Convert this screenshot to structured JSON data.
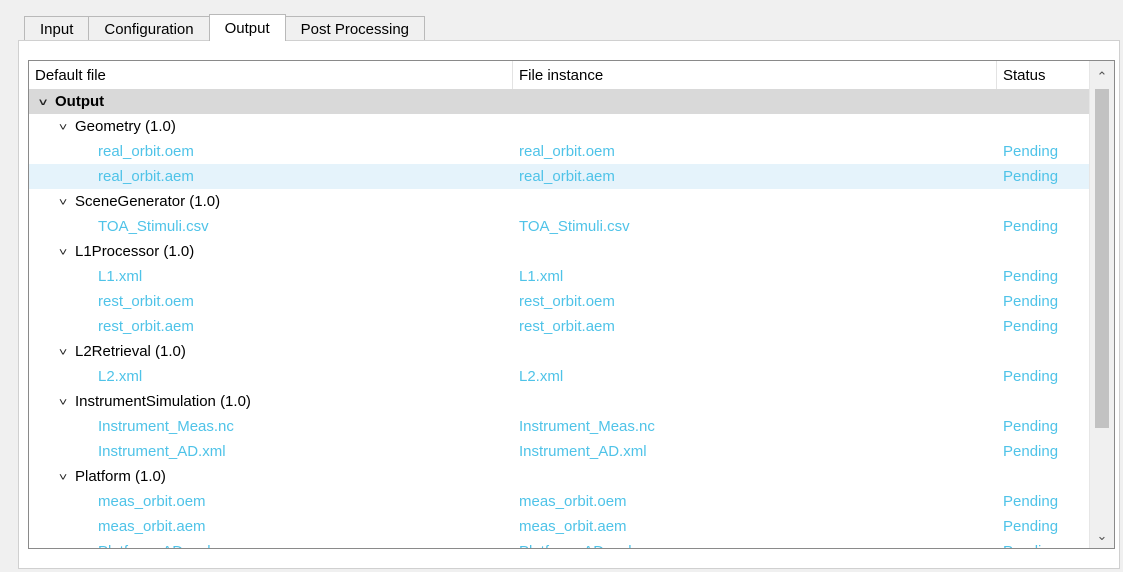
{
  "tabs": [
    {
      "label": "Input"
    },
    {
      "label": "Configuration"
    },
    {
      "label": "Output"
    },
    {
      "label": "Post Processing"
    }
  ],
  "active_tab": "Output",
  "columns": {
    "default_file": "Default file",
    "file_instance": "File instance",
    "status": "Status"
  },
  "icons": {
    "expand": "chevron-down-icon",
    "scroll_up": "scroll-up-arrow-icon",
    "scroll_down": "scroll-down-arrow-icon"
  },
  "colors": {
    "file_text": "#4fc3e8",
    "root_row_bg": "#d9d9d9",
    "selected_row_bg": "#e5f3fb"
  },
  "rows": [
    {
      "type": "root",
      "label": "Output"
    },
    {
      "type": "group",
      "label": "Geometry (1.0)"
    },
    {
      "type": "file",
      "default": "real_orbit.oem",
      "instance": "real_orbit.oem",
      "status": "Pending"
    },
    {
      "type": "file",
      "default": "real_orbit.aem",
      "instance": "real_orbit.aem",
      "status": "Pending",
      "selected": true
    },
    {
      "type": "group",
      "label": "SceneGenerator (1.0)"
    },
    {
      "type": "file",
      "default": "TOA_Stimuli.csv",
      "instance": "TOA_Stimuli.csv",
      "status": "Pending"
    },
    {
      "type": "group",
      "label": "L1Processor (1.0)"
    },
    {
      "type": "file",
      "default": "L1.xml",
      "instance": "L1.xml",
      "status": "Pending"
    },
    {
      "type": "file",
      "default": "rest_orbit.oem",
      "instance": "rest_orbit.oem",
      "status": "Pending"
    },
    {
      "type": "file",
      "default": "rest_orbit.aem",
      "instance": "rest_orbit.aem",
      "status": "Pending"
    },
    {
      "type": "group",
      "label": "L2Retrieval (1.0)"
    },
    {
      "type": "file",
      "default": "L2.xml",
      "instance": "L2.xml",
      "status": "Pending"
    },
    {
      "type": "group",
      "label": "InstrumentSimulation (1.0)"
    },
    {
      "type": "file",
      "default": "Instrument_Meas.nc",
      "instance": "Instrument_Meas.nc",
      "status": "Pending"
    },
    {
      "type": "file",
      "default": "Instrument_AD.xml",
      "instance": "Instrument_AD.xml",
      "status": "Pending"
    },
    {
      "type": "group",
      "label": "Platform (1.0)"
    },
    {
      "type": "file",
      "default": "meas_orbit.oem",
      "instance": "meas_orbit.oem",
      "status": "Pending"
    },
    {
      "type": "file",
      "default": "meas_orbit.aem",
      "instance": "meas_orbit.aem",
      "status": "Pending"
    },
    {
      "type": "file",
      "default": "Platform_AD.xml",
      "instance": "Platform_AD.xml",
      "status": "Pending"
    }
  ]
}
